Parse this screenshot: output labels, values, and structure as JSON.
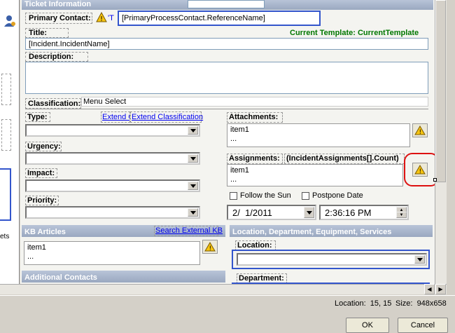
{
  "ticket": {
    "header": "Ticket Information",
    "primary_contact_label": "Primary Contact:",
    "primary_contact_fragment": "'T",
    "primary_contact_value": "[PrimaryProcessContact.ReferenceName]",
    "title_label": "Title:",
    "current_template": "Current Template:  CurrentTemplate",
    "title_value": "[Incident.IncidentName]",
    "description_label": "Description:"
  },
  "classification": {
    "label": "Classification:",
    "menu_select": "Menu Select",
    "type_label": "Type:",
    "extend_c": "Extend C",
    "extend_classification": "Extend Classification",
    "urgency_label": "Urgency:",
    "impact_label": "Impact:",
    "priority_label": "Priority:"
  },
  "attachments": {
    "label": "Attachments:",
    "items": [
      "item1",
      "..."
    ]
  },
  "assignments": {
    "label": "Assignments:",
    "count": "(IncidentAssignments[].Count)",
    "items": [
      "item1",
      "..."
    ],
    "follow_the_sun": "Follow the Sun",
    "postpone_date": "Postpone Date",
    "date_value": "2/  1/2011",
    "time_value": "2:36:16 PM"
  },
  "kb": {
    "header": "KB Articles",
    "search_link": "Search External KB",
    "items": [
      "item1",
      "..."
    ]
  },
  "location_section": {
    "header": "Location, Department, Equipment, Services",
    "location_label": "Location:",
    "department_label": "Department:"
  },
  "additional_contacts": {
    "header": "Additional Contacts"
  },
  "left_panel": {
    "fragment": "ets"
  },
  "status": {
    "location": "Location:  15, 15",
    "size": "Size:  948x658"
  },
  "buttons": {
    "ok": "OK",
    "cancel": "Cancel"
  },
  "colors": {
    "highlight_blue": "#3355cc",
    "callout_red": "#dd1111",
    "template_green": "#007700"
  }
}
